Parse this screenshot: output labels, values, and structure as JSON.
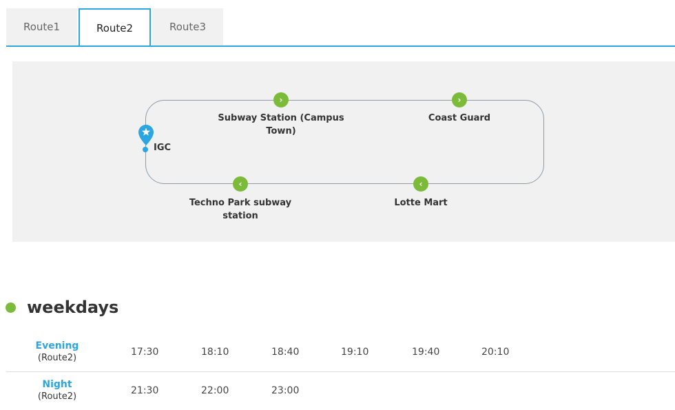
{
  "tabs": [
    {
      "label": "Route1",
      "active": false
    },
    {
      "label": "Route2",
      "active": true
    },
    {
      "label": "Route3",
      "active": false
    }
  ],
  "map": {
    "start": {
      "label": "IGC",
      "icon": "star-pin-icon"
    },
    "stops": [
      {
        "label": "Subway Station (Campus Town)",
        "direction": "right",
        "icon": "chevron-right-icon"
      },
      {
        "label": "Coast Guard",
        "direction": "right",
        "icon": "chevron-right-icon"
      },
      {
        "label": "Lotte Mart",
        "direction": "left",
        "icon": "chevron-left-icon"
      },
      {
        "label": "Techno Park subway station",
        "direction": "left",
        "icon": "chevron-left-icon"
      }
    ]
  },
  "schedule": {
    "title": "weekdays",
    "rows": [
      {
        "name": "Evening",
        "route": "(Route2)",
        "times": [
          "17:30",
          "18:10",
          "18:40",
          "19:10",
          "19:40",
          "20:10"
        ]
      },
      {
        "name": "Night",
        "route": "(Route2)",
        "times": [
          "21:30",
          "22:00",
          "23:00"
        ]
      }
    ]
  },
  "colors": {
    "accent": "#2ba6e1",
    "stop_green": "#7cbb3a",
    "panel_bg": "#f1f1f1"
  }
}
